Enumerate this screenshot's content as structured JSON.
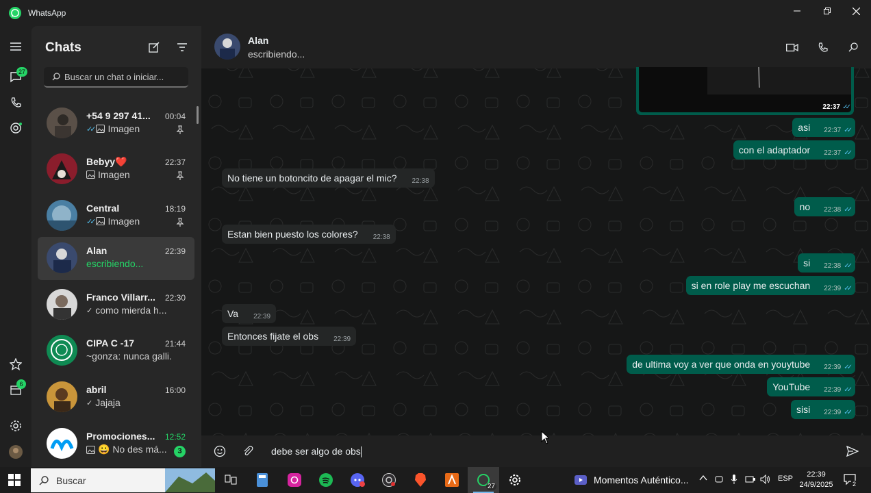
{
  "window": {
    "title": "WhatsApp"
  },
  "rail": {
    "chats_badge": "27",
    "status_badge": "6"
  },
  "chatlist": {
    "heading": "Chats",
    "search_placeholder": "Buscar un chat o iniciar...",
    "items": [
      {
        "name": "+54 9 297 41...",
        "time": "00:04",
        "preview": "Imagen",
        "tick": "✓✓",
        "media": true,
        "pinned": true
      },
      {
        "name": "Bebyy❤️",
        "time": "22:37",
        "preview": "Imagen",
        "tick": "",
        "media": true,
        "pinned": true
      },
      {
        "name": "Central",
        "time": "18:19",
        "preview": "Imagen",
        "tick": "✓✓",
        "media": true,
        "pinned": true
      },
      {
        "name": "Alan",
        "time": "22:39",
        "preview": "escribiendo...",
        "tick": "",
        "media": false,
        "pinned": false
      },
      {
        "name": "Franco Villarr...",
        "time": "22:30",
        "preview": "como mierda h...",
        "tick": "✓",
        "media": false,
        "pinned": false
      },
      {
        "name": "CIPA  C -17",
        "time": "21:44",
        "preview": "~gonza: nunca galli...",
        "tick": "",
        "media": false,
        "pinned": false
      },
      {
        "name": "abril",
        "time": "16:00",
        "preview": "Jajaja",
        "tick": "✓",
        "media": false,
        "pinned": false
      },
      {
        "name": "Promociones...",
        "time": "12:52",
        "preview": "😀 No des má...",
        "tick": "",
        "media": true,
        "pinned": false,
        "unread": "3"
      }
    ]
  },
  "conversation": {
    "name": "Alan",
    "status": "escribiendo...",
    "image_time": "22:37",
    "messages": [
      {
        "dir": "out",
        "text": "asi",
        "time": "22:37"
      },
      {
        "dir": "out",
        "text": "con el adaptador",
        "time": "22:37"
      },
      {
        "dir": "in",
        "text": "No tiene un botoncito de apagar el mic?",
        "time": "22:38"
      },
      {
        "dir": "out",
        "text": "no",
        "time": "22:38"
      },
      {
        "dir": "in",
        "text": "Estan bien puesto los colores?",
        "time": "22:38"
      },
      {
        "dir": "out",
        "text": "si",
        "time": "22:38"
      },
      {
        "dir": "out",
        "text": "si en role play me escuchan",
        "time": "22:39"
      },
      {
        "dir": "in",
        "text": "Va",
        "time": "22:39"
      },
      {
        "dir": "in",
        "text": "Entonces fijate el obs",
        "time": "22:39"
      },
      {
        "dir": "out",
        "text": "de ultima voy a ver que onda en youytube",
        "time": "22:39"
      },
      {
        "dir": "out",
        "text": "YouTube",
        "time": "22:39"
      },
      {
        "dir": "out",
        "text": "sisi",
        "time": "22:39"
      }
    ],
    "composer_text": "debe ser algo de obs"
  },
  "taskbar": {
    "search_label": "Buscar",
    "whatsapp_badge": "27",
    "running_window": "Momentos Auténtico...",
    "language": "ESP",
    "time": "22:39",
    "date": "24/9/2025",
    "notifications": "2"
  },
  "colors": {
    "accent": "#25d366",
    "outgoing": "#005c4b",
    "incoming": "#242626",
    "read_tick": "#53bdeb"
  }
}
